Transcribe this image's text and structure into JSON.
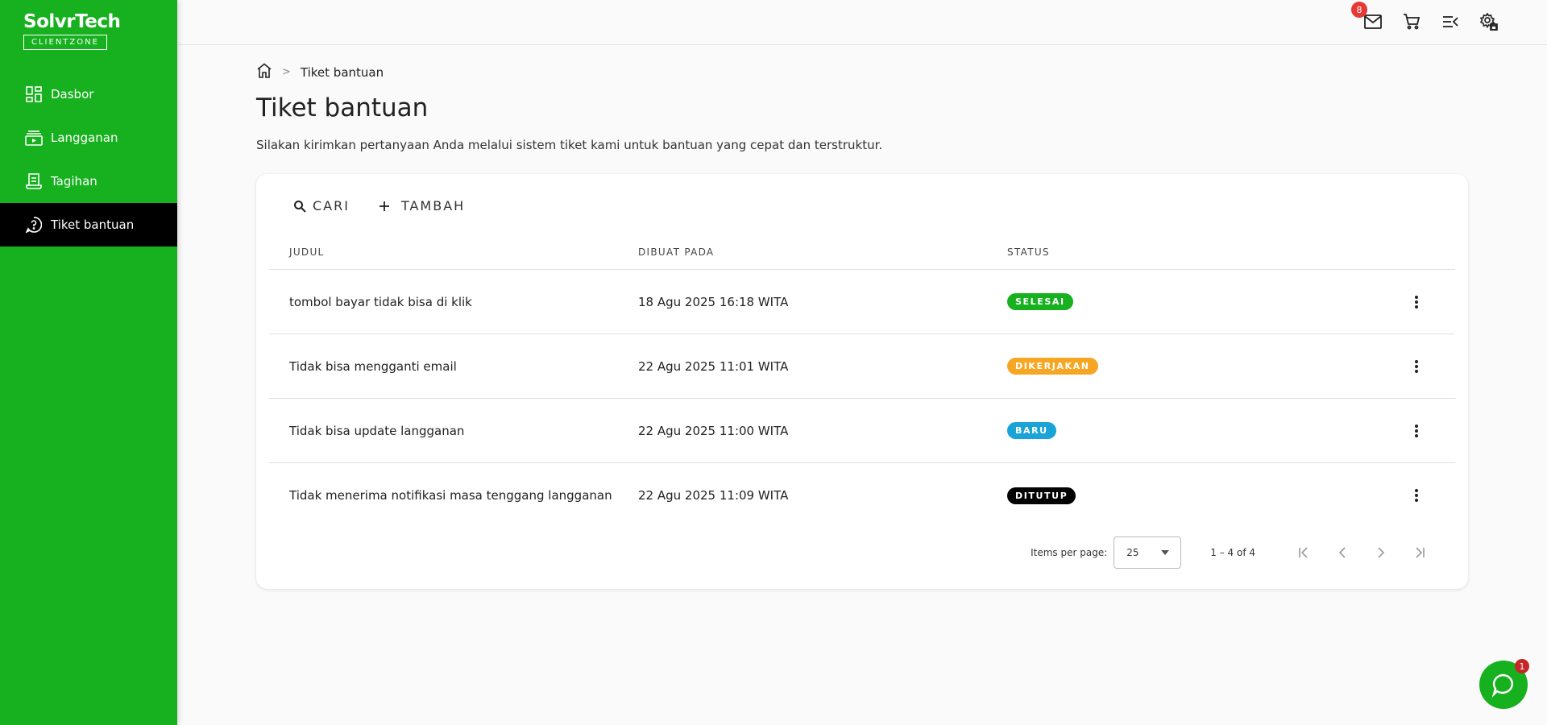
{
  "brand": {
    "name_part1": "Solvr",
    "name_part2": "Tech",
    "subtitle": "CLIENTZONE"
  },
  "sidebar": {
    "items": [
      {
        "label": "Dasbor",
        "icon": "dashboard-icon"
      },
      {
        "label": "Langganan",
        "icon": "subscription-icon"
      },
      {
        "label": "Tagihan",
        "icon": "receipt-icon"
      },
      {
        "label": "Tiket bantuan",
        "icon": "help-icon",
        "active": true
      }
    ]
  },
  "topbar": {
    "mail_badge": "8"
  },
  "breadcrumb": {
    "current": "Tiket bantuan"
  },
  "page": {
    "title": "Tiket bantuan",
    "description": "Silakan kirimkan pertanyaan Anda melalui sistem tiket kami untuk bantuan yang cepat dan terstruktur."
  },
  "toolbar": {
    "search_label": "CARI",
    "add_label": "TAMBAH"
  },
  "table": {
    "headers": [
      "JUDUL",
      "DIBUAT PADA",
      "STATUS"
    ],
    "rows": [
      {
        "title": "tombol bayar tidak bisa di klik",
        "created": "18 Agu 2025 16:18 WITA",
        "status": "SELESAI",
        "status_color": "#17b11f"
      },
      {
        "title": "Tidak bisa mengganti email",
        "created": "22 Agu 2025 11:01 WITA",
        "status": "DIKERJAKAN",
        "status_color": "#f5a623"
      },
      {
        "title": "Tidak bisa update langganan",
        "created": "22 Agu 2025 11:00 WITA",
        "status": "BARU",
        "status_color": "#1aa3d6"
      },
      {
        "title": "Tidak menerima notifikasi masa tenggang langganan",
        "created": "22 Agu 2025 11:09 WITA",
        "status": "DITUTUP",
        "status_color": "#000000"
      }
    ]
  },
  "pager": {
    "label": "Items per page:",
    "per_page": "25",
    "range": "1 – 4 of 4"
  },
  "chat": {
    "badge": "1"
  }
}
